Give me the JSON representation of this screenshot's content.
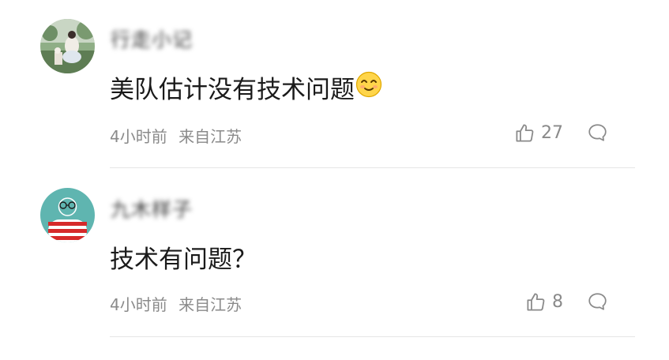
{
  "comments": [
    {
      "username": "行走小记",
      "text": "美队估计没有技术问题",
      "emoji_icon": "wink-face-emoji-icon",
      "time": "4小时前",
      "location": "来自江苏",
      "likes": "27"
    },
    {
      "username": "九木样子",
      "text": "技术有问题？",
      "time": "4小时前",
      "location": "来自江苏",
      "likes": "8"
    }
  ],
  "icons": {
    "like": "thumbs-up-icon",
    "reply": "speech-bubble-icon"
  },
  "colors": {
    "text": "#1a1a1a",
    "meta": "#8a8a8a",
    "divider": "#e6e6e6"
  }
}
